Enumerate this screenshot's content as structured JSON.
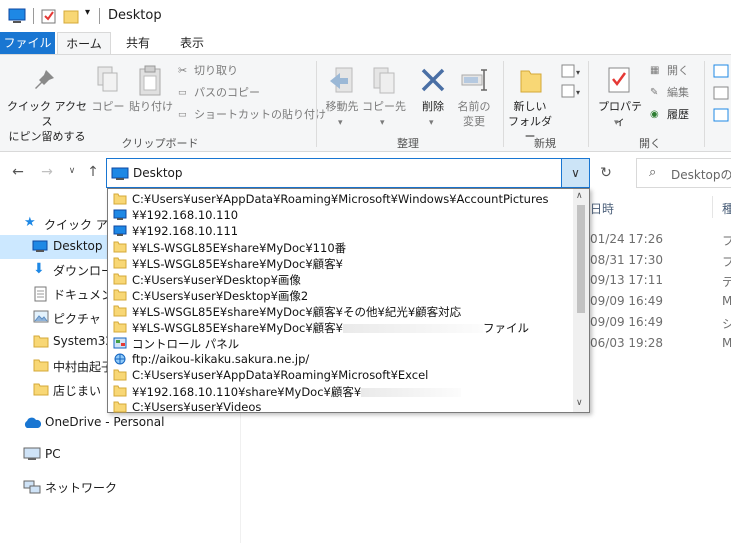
{
  "window": {
    "title": "Desktop"
  },
  "tabs": {
    "file": "ファイル",
    "home": "ホーム",
    "share": "共有",
    "view": "表示"
  },
  "ribbon": {
    "pin_label": "クイック アクセス\nにピン留めする",
    "copy_label": "コピー",
    "paste_label": "貼り付け",
    "cut_label": "切り取り",
    "copy_path_label": "パスのコピー",
    "paste_shortcut_label": "ショートカットの貼り付け",
    "clipboard_group": "クリップボード",
    "move_to_label": "移動先",
    "copy_to_label": "コピー先",
    "delete_label": "削除",
    "rename_label": "名前の\n変更",
    "organize_group": "整理",
    "new_folder_label": "新しい\nフォルダー",
    "new_group": "新規",
    "properties_label": "プロパティ",
    "open_label": "開く",
    "edit_label": "編集",
    "history_label": "履歴",
    "open_group": "開く"
  },
  "address": {
    "value": "Desktop",
    "search_placeholder": "Desktopの検"
  },
  "sidebar": {
    "items": [
      {
        "label": "クイック アクセ"
      },
      {
        "label": "Desktop"
      },
      {
        "label": "ダウンロード"
      },
      {
        "label": "ドキュメント"
      },
      {
        "label": "ピクチャ"
      },
      {
        "label": "System32"
      },
      {
        "label": "中村由起子"
      },
      {
        "label": "店じまい"
      },
      {
        "label": "OneDrive - Personal"
      },
      {
        "label": "PC"
      },
      {
        "label": "ネットワーク"
      }
    ]
  },
  "columns": {
    "date": "日時",
    "type": "種"
  },
  "rows": [
    {
      "date": "01/24 17:26",
      "type": "フ"
    },
    {
      "date": "08/31 17:30",
      "type": "フ"
    },
    {
      "date": "09/13 17:11",
      "type": "テ"
    },
    {
      "date": "09/09 16:49",
      "type": "M"
    },
    {
      "date": "09/09 16:49",
      "type": "シ"
    },
    {
      "date": "06/03 19:28",
      "type": "M"
    }
  ],
  "dropdown": {
    "items": [
      {
        "text": "C:¥Users¥user¥AppData¥Roaming¥Microsoft¥Windows¥AccountPictures",
        "icon": "folder"
      },
      {
        "text": "¥¥192.168.10.110",
        "icon": "computer"
      },
      {
        "text": "¥¥192.168.10.111",
        "icon": "computer"
      },
      {
        "text": "¥¥LS-WSGL85E¥share¥MyDoc¥110番",
        "icon": "folder"
      },
      {
        "text": "¥¥LS-WSGL85E¥share¥MyDoc¥顧客¥",
        "icon": "folder"
      },
      {
        "text": "C:¥Users¥user¥Desktop¥画像",
        "icon": "folder"
      },
      {
        "text": "C:¥Users¥user¥Desktop¥画像2",
        "icon": "folder"
      },
      {
        "text": "¥¥LS-WSGL85E¥share¥MyDoc¥顧客¥その他¥紀光¥顧客対応",
        "icon": "folder"
      },
      {
        "text": "¥¥LS-WSGL85E¥share¥MyDoc¥顧客¥",
        "tail": "ファイル",
        "icon": "folder"
      },
      {
        "text": "コントロール パネル",
        "icon": "control-panel"
      },
      {
        "text": "ftp://aikou-kikaku.sakura.ne.jp/",
        "icon": "ftp"
      },
      {
        "text": "C:¥Users¥user¥AppData¥Roaming¥Microsoft¥Excel",
        "icon": "folder"
      },
      {
        "text": "¥¥192.168.10.110¥share¥MyDoc¥顧客¥",
        "icon": "folder"
      },
      {
        "text": "C:¥Users¥user¥Videos",
        "icon": "folder"
      }
    ]
  },
  "colors": {
    "accent": "#1976d2",
    "selection": "#cce8ff",
    "folder": "#f8d775"
  }
}
